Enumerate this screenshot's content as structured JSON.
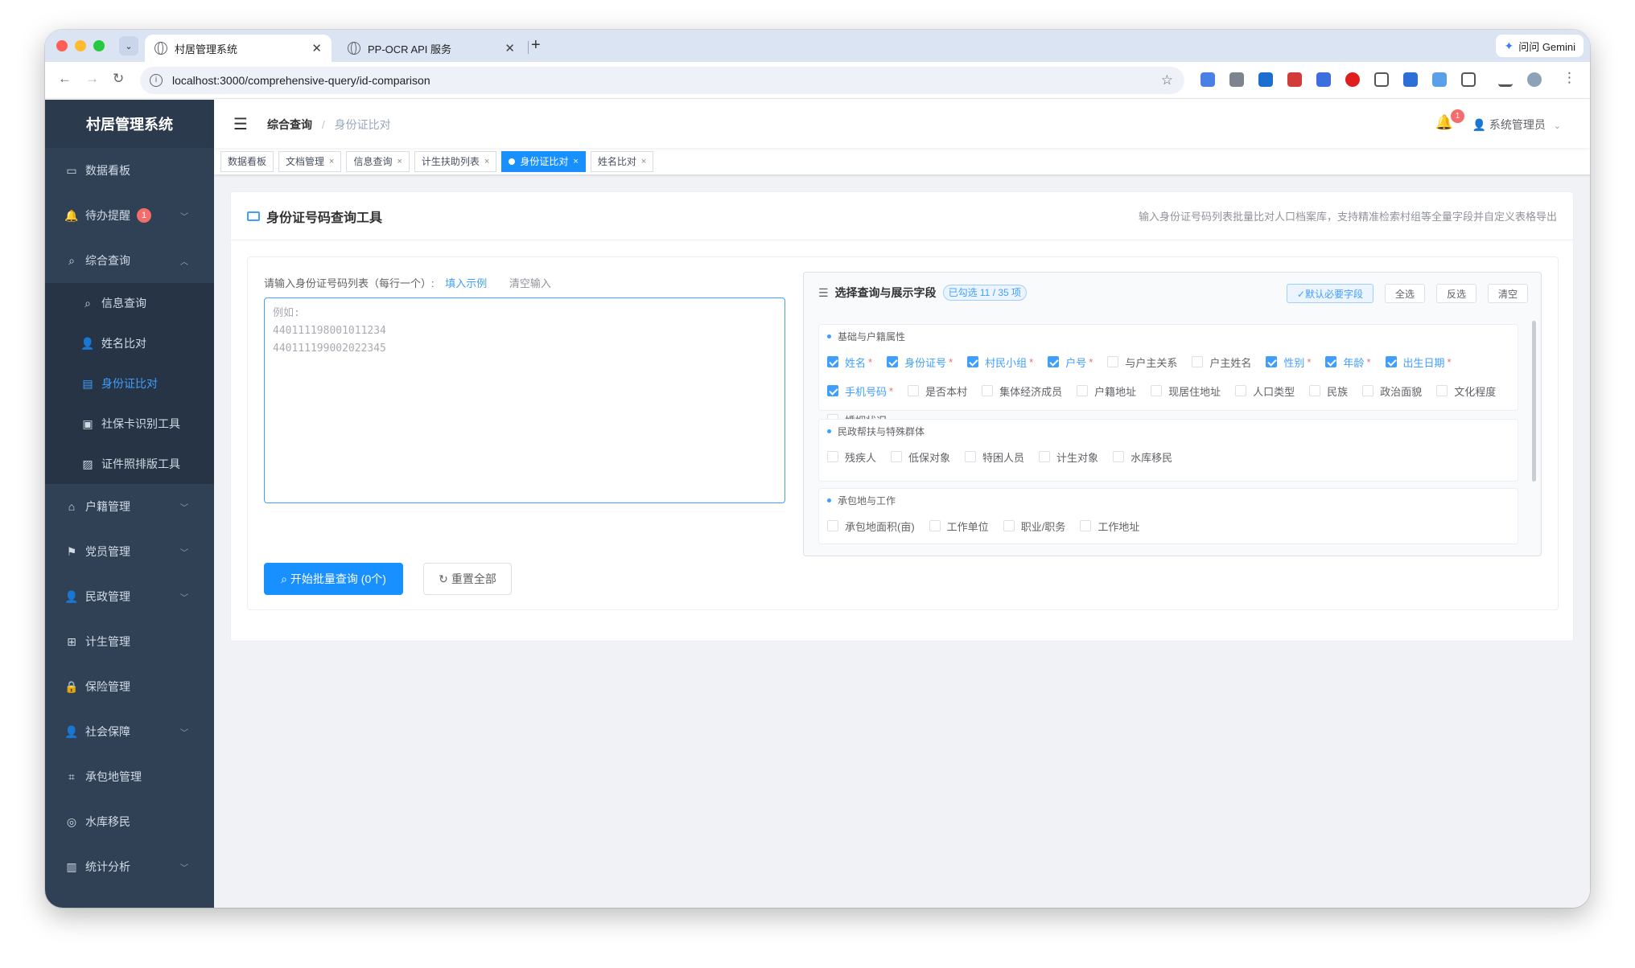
{
  "browser": {
    "tabs": [
      {
        "title": "村居管理系统",
        "active": true
      },
      {
        "title": "PP-OCR API 服务",
        "active": false
      }
    ],
    "gemini_label": "问问 Gemini",
    "url": "localhost:3000/comprehensive-query/id-comparison"
  },
  "app": {
    "title": "村居管理系统",
    "accent_color": "#1890ff",
    "sidebar_bg": "#304156"
  },
  "sidebar": {
    "items": [
      {
        "label": "数据看板",
        "icon": "dashboard-icon"
      },
      {
        "label": "待办提醒",
        "icon": "bell-icon",
        "badge": "1",
        "expandable": true
      },
      {
        "label": "综合查询",
        "icon": "search-icon",
        "expanded": true
      },
      {
        "label": "信息查询",
        "icon": "search-icon",
        "sub": true
      },
      {
        "label": "姓名比对",
        "icon": "user-icon",
        "sub": true
      },
      {
        "label": "身份证比对",
        "icon": "id-card-icon",
        "sub": true,
        "active": true
      },
      {
        "label": "社保卡识别工具",
        "icon": "card-icon",
        "sub": true
      },
      {
        "label": "证件照排版工具",
        "icon": "picture-icon",
        "sub": true
      },
      {
        "label": "户籍管理",
        "icon": "home-icon",
        "expandable": true
      },
      {
        "label": "党员管理",
        "icon": "flag-icon",
        "expandable": true
      },
      {
        "label": "民政管理",
        "icon": "user-icon",
        "expandable": true
      },
      {
        "label": "计生管理",
        "icon": "medical-box-icon"
      },
      {
        "label": "保险管理",
        "icon": "lock-icon"
      },
      {
        "label": "社会保障",
        "icon": "user-icon",
        "expandable": true
      },
      {
        "label": "承包地管理",
        "icon": "crop-icon"
      },
      {
        "label": "水库移民",
        "icon": "location-icon"
      },
      {
        "label": "统计分析",
        "icon": "chart-icon",
        "expandable": true
      }
    ]
  },
  "navbar": {
    "breadcrumb": [
      "综合查询",
      "身份证比对"
    ],
    "notification_count": "1",
    "user": "系统管理员"
  },
  "tags": [
    {
      "label": "数据看板",
      "closable": false
    },
    {
      "label": "文档管理",
      "closable": true
    },
    {
      "label": "信息查询",
      "closable": true
    },
    {
      "label": "计生扶助列表",
      "closable": true
    },
    {
      "label": "身份证比对",
      "closable": true,
      "active": true
    },
    {
      "label": "姓名比对",
      "closable": true
    }
  ],
  "card": {
    "title": "身份证号码查询工具",
    "description": "输入身份证号码列表批量比对人口档案库，支持精准检索村组等全量字段并自定义表格导出",
    "input_label": "请输入身份证号码列表（每行一个）:",
    "fill_example": "填入示例",
    "clear_input": "清空输入",
    "placeholder": "例如:\n440111198001011234\n440111199002022345",
    "query_button": "开始批量查询 (0个)",
    "reset_button": "重置全部"
  },
  "fields_panel": {
    "title": "选择查询与展示字段",
    "selected_text": "已勾选 11 / 35 项",
    "buttons": [
      "✓默认必要字段",
      "全选",
      "反选",
      "清空"
    ],
    "groups": [
      {
        "title": "基础与户籍属性",
        "fields": [
          {
            "label": "姓名",
            "checked": true,
            "required": true
          },
          {
            "label": "身份证号",
            "checked": true,
            "required": true
          },
          {
            "label": "村民小组",
            "checked": true,
            "required": true
          },
          {
            "label": "户号",
            "checked": true,
            "required": true
          },
          {
            "label": "与户主关系",
            "checked": false
          },
          {
            "label": "户主姓名",
            "checked": false
          },
          {
            "label": "性别",
            "checked": true,
            "required": true
          },
          {
            "label": "年龄",
            "checked": true,
            "required": true
          },
          {
            "label": "出生日期",
            "checked": true,
            "required": true
          },
          {
            "label": "手机号码",
            "checked": true,
            "required": true
          },
          {
            "label": "是否本村",
            "checked": false
          },
          {
            "label": "集体经济成员",
            "checked": false
          },
          {
            "label": "户籍地址",
            "checked": false
          },
          {
            "label": "现居住地址",
            "checked": false
          },
          {
            "label": "人口类型",
            "checked": false
          },
          {
            "label": "民族",
            "checked": false
          },
          {
            "label": "政治面貌",
            "checked": false
          },
          {
            "label": "文化程度",
            "checked": false
          },
          {
            "label": "婚姻状况",
            "checked": false
          }
        ]
      },
      {
        "title": "民政帮扶与特殊群体",
        "fields": [
          {
            "label": "残疾人",
            "checked": false
          },
          {
            "label": "低保对象",
            "checked": false
          },
          {
            "label": "特困人员",
            "checked": false
          },
          {
            "label": "计生对象",
            "checked": false
          },
          {
            "label": "水库移民",
            "checked": false
          }
        ]
      },
      {
        "title": "承包地与工作",
        "fields": [
          {
            "label": "承包地面积(亩)",
            "checked": false
          },
          {
            "label": "工作单位",
            "checked": false
          },
          {
            "label": "职业/职务",
            "checked": false
          },
          {
            "label": "工作地址",
            "checked": false
          }
        ]
      }
    ]
  }
}
